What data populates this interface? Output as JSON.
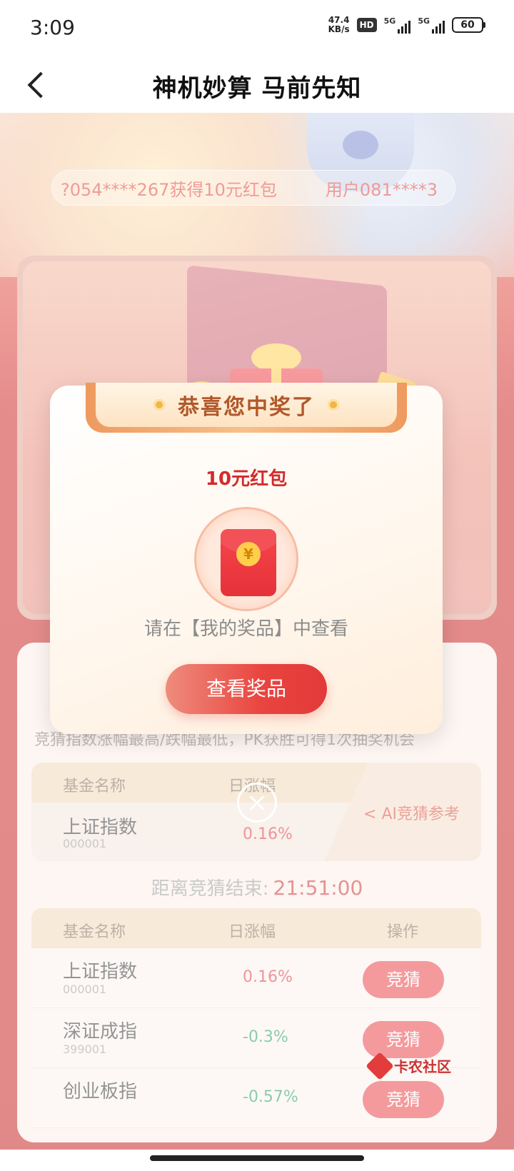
{
  "status_bar": {
    "time": "3:09",
    "net_speed_value": "47.4",
    "net_speed_unit": "KB/s",
    "hd": "HD",
    "signal1": "5G",
    "signal2": "5G",
    "battery": "60"
  },
  "header": {
    "title": "神机妙算  马前先知"
  },
  "ticker": {
    "items": [
      "?054****267获得10元红包",
      "用户081****3"
    ]
  },
  "game": {
    "rules": "竞猜指数涨幅最高/跌幅最低，PK获胜可得1次抽奖机会",
    "pk": {
      "col_name": "基金名称",
      "col_change": "日涨幅",
      "fund_name": "上证指数",
      "fund_code": "000001",
      "fund_change": "0.16%",
      "ai_label": "< AI竞猜参考"
    },
    "countdown_label": "距离竞猜结束:",
    "countdown_time": "21:51:00",
    "list": {
      "col_name": "基金名称",
      "col_change": "日涨幅",
      "col_action": "操作",
      "rows": [
        {
          "name": "上证指数",
          "code": "000001",
          "change": "0.16%",
          "action": "竞猜"
        },
        {
          "name": "深证成指",
          "code": "399001",
          "change": "-0.3%",
          "action": "竞猜"
        },
        {
          "name": "创业板指",
          "code": "",
          "change": "-0.57%",
          "action": "竞猜"
        }
      ]
    }
  },
  "modal": {
    "title": "恭喜您中奖了",
    "prize_name": "10元红包",
    "coin_symbol": "¥",
    "hint": "请在【我的奖品】中查看",
    "button": "查看奖品"
  },
  "watermark": "卡农社区",
  "colors": {
    "accent_red": "#e23a3a",
    "up": "#e0323b",
    "down": "#1e9e5a"
  }
}
